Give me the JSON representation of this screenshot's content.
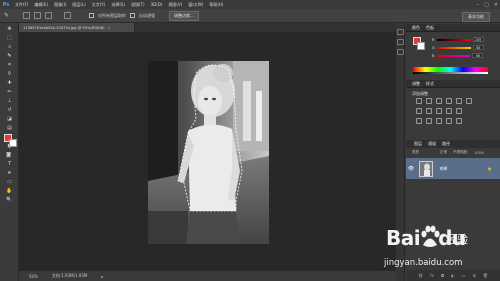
{
  "app": {
    "logo": "Ps"
  },
  "menu": [
    "文件(F)",
    "编辑(E)",
    "图像(I)",
    "图层(L)",
    "文字(Y)",
    "选择(S)",
    "滤镜(T)",
    "3D(D)",
    "视图(V)",
    "窗口(W)",
    "帮助(H)"
  ],
  "window_controls": [
    "–",
    "□",
    "✕"
  ],
  "options": {
    "auto_enhance": "自动增强",
    "sample_all": "对所有图层取样",
    "refine_edge": "调整边缘...",
    "workspace": "基本功能"
  },
  "document": {
    "tab_title": "11365761e4b02b-20472a.jpg @ 50%(RGB/8)",
    "close": "×"
  },
  "status": {
    "zoom": "50%",
    "doc_size": "文档:1.93M/1.93M",
    "arrow": "▸"
  },
  "panels": {
    "color_tabs": [
      "颜色",
      "色板"
    ],
    "sliders": [
      {
        "label": "R",
        "value": "209",
        "color": "#d03030"
      },
      {
        "label": "G",
        "value": "66",
        "color": "#30a030"
      },
      {
        "label": "B",
        "value": "66",
        "color": "#3060d0"
      }
    ],
    "adjust_tabs": [
      "调整",
      "样式"
    ],
    "adjust_title": "添加调整",
    "layers_tabs": [
      "图层",
      "通道",
      "路径"
    ],
    "layer_kind": "类型",
    "blend_mode": "正常",
    "opacity_label": "不透明度:",
    "opacity": "100%",
    "lock_label": "锁定:",
    "fill_label": "填充:",
    "fill": "100%",
    "layer_name": "背景",
    "lock_icon": "🔒"
  },
  "watermark": {
    "brand": "Bai",
    "brand2": "du",
    "cn": "经验",
    "url": "jingyan.baidu.com"
  },
  "colors": {
    "foreground": "#e13a3a",
    "background": "#ffffff",
    "layer_selected": "#5a6e8c"
  }
}
